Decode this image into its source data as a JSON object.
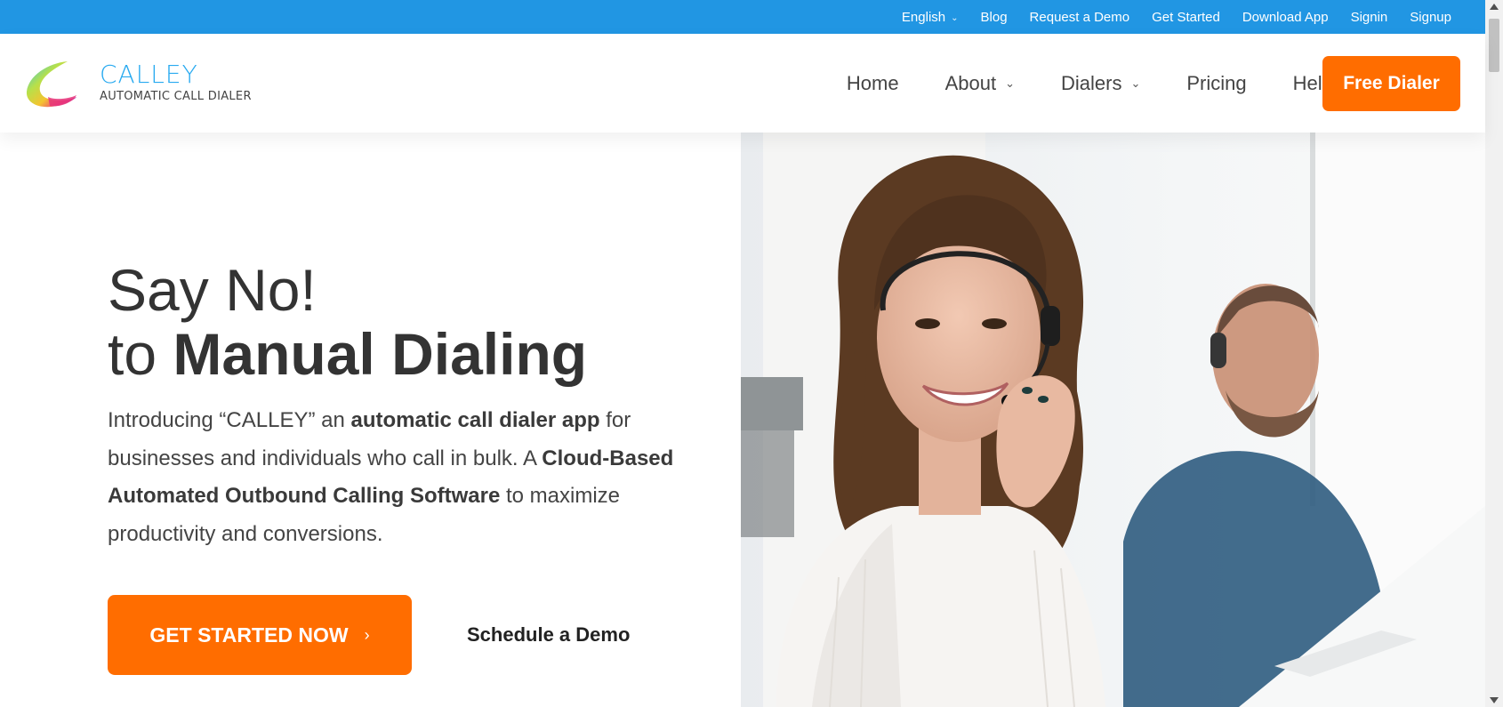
{
  "topbar": {
    "language": "English",
    "links": [
      "Blog",
      "Request a Demo",
      "Get Started",
      "Download App",
      "Signin",
      "Signup"
    ]
  },
  "header": {
    "logo_title": "CALLEY",
    "logo_sub": "AUTOMATIC CALL DIALER",
    "nav": {
      "home": "Home",
      "about": "About",
      "dialers": "Dialers",
      "pricing": "Pricing",
      "help": "Help?"
    },
    "cta": "Free Dialer"
  },
  "hero": {
    "line1": "Say No!",
    "line2_prefix": "to ",
    "line2_bold": "Manual Dialing",
    "lead_1": "Introducing “CALLEY” an ",
    "lead_b1": "automatic call dialer app",
    "lead_2": " for businesses and individuals who call in bulk. A ",
    "lead_b2": "Cloud-Based Automated Outbound Calling Software",
    "lead_3": " to maximize productivity and conversions.",
    "primary_cta": "GET STARTED NOW",
    "secondary_cta": "Schedule a Demo"
  },
  "colors": {
    "topbar": "#2196e3",
    "accent": "#ff6d00",
    "logo_blue": "#29aaf0"
  },
  "icons": [
    "calley-logo-icon",
    "chevron-down-icon",
    "chevron-right-icon"
  ]
}
